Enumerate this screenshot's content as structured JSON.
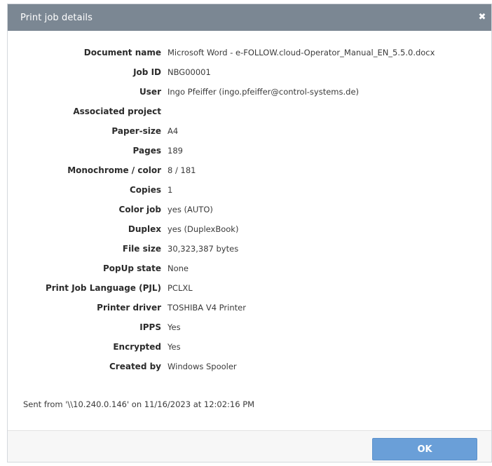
{
  "dialog": {
    "title": "Print job details",
    "close_icon": "close-icon",
    "close_glyph": "✖"
  },
  "details": [
    {
      "label": "Document name",
      "value": "Microsoft Word - e-FOLLOW.cloud-Operator_Manual_EN_5.5.0.docx"
    },
    {
      "label": "Job ID",
      "value": "NBG00001"
    },
    {
      "label": "User",
      "value": "Ingo Pfeiffer (ingo.pfeiffer@control-systems.de)"
    },
    {
      "label": "Associated project",
      "value": ""
    },
    {
      "label": "Paper-size",
      "value": "A4"
    },
    {
      "label": "Pages",
      "value": "189"
    },
    {
      "label": "Monochrome / color",
      "value": "8 / 181"
    },
    {
      "label": "Copies",
      "value": "1"
    },
    {
      "label": "Color job",
      "value": "yes (AUTO)"
    },
    {
      "label": "Duplex",
      "value": "yes (DuplexBook)"
    },
    {
      "label": "File size",
      "value": "30,323,387 bytes"
    },
    {
      "label": "PopUp state",
      "value": "None"
    },
    {
      "label": "Print Job Language (PJL)",
      "value": "PCLXL"
    },
    {
      "label": "Printer driver",
      "value": "TOSHIBA V4 Printer"
    },
    {
      "label": "IPPS",
      "value": "Yes"
    },
    {
      "label": "Encrypted",
      "value": "Yes"
    },
    {
      "label": "Created by",
      "value": "Windows Spooler"
    }
  ],
  "sent_info": "Sent from '\\\\10.240.0.146' on 11/16/2023 at 12:02:16 PM",
  "footer": {
    "ok_label": "OK"
  },
  "colors": {
    "titlebar": "#7b8793",
    "ok_button": "#6a9fd8"
  }
}
